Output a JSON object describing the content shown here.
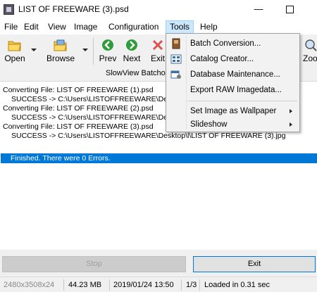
{
  "window": {
    "title": "LIST OF FREEWARE (3).psd",
    "minimize_glyph": "—"
  },
  "menubar": {
    "items": [
      "File",
      "Edit",
      "View",
      "Image",
      "Configuration",
      "Tools",
      "Help"
    ]
  },
  "toolbar": {
    "open_label": "Open",
    "browse_label": "Browse",
    "prev_label": "Prev",
    "next_label": "Next",
    "exit_label": "Exit",
    "zoom_label": "Zoo",
    "batch_label": "SlowView Batcho"
  },
  "log": {
    "lines": [
      "Converting File: LIST OF FREEWARE (1).psd",
      "SUCCESS -> C:\\Users\\LISTOFFREEWARE\\Desk",
      "Converting File: LIST OF FREEWARE (2).psd",
      "SUCCESS -> C:\\Users\\LISTOFFREEWARE\\Desk",
      "Converting File: LIST OF FREEWARE (3).psd",
      "SUCCESS -> C:\\Users\\LISTOFFREEWARE\\Desktop\\l\\LIST OF FREEWARE (3).jpg"
    ],
    "finished": "Finished. There were 0 Errors."
  },
  "buttons": {
    "stop_label": "Stop",
    "exit_label": "Exit"
  },
  "status": {
    "dimensions": "2480x3508x24",
    "filesize": "44.23 MB",
    "datetime": "2019/01/24 13:50",
    "page": "1/3",
    "loadtime": "Loaded in 0.31 sec"
  },
  "tools_menu": {
    "items": [
      {
        "label": "Batch Conversion...",
        "icon": "batch-conversion-icon",
        "submenu": false
      },
      {
        "label": "Catalog Creator...",
        "icon": "catalog-creator-icon",
        "submenu": false
      },
      {
        "label": "Database Maintenance...",
        "icon": "database-maintenance-icon",
        "submenu": false
      },
      {
        "label": "Export RAW Imagedata...",
        "icon": "",
        "submenu": false
      },
      {
        "label": "Set Image as Wallpaper",
        "icon": "",
        "submenu": true
      },
      {
        "label": "Slideshow",
        "icon": "",
        "submenu": true
      }
    ]
  },
  "colors": {
    "selection": "#0078d7",
    "menu_highlight": "#cce8ff"
  }
}
